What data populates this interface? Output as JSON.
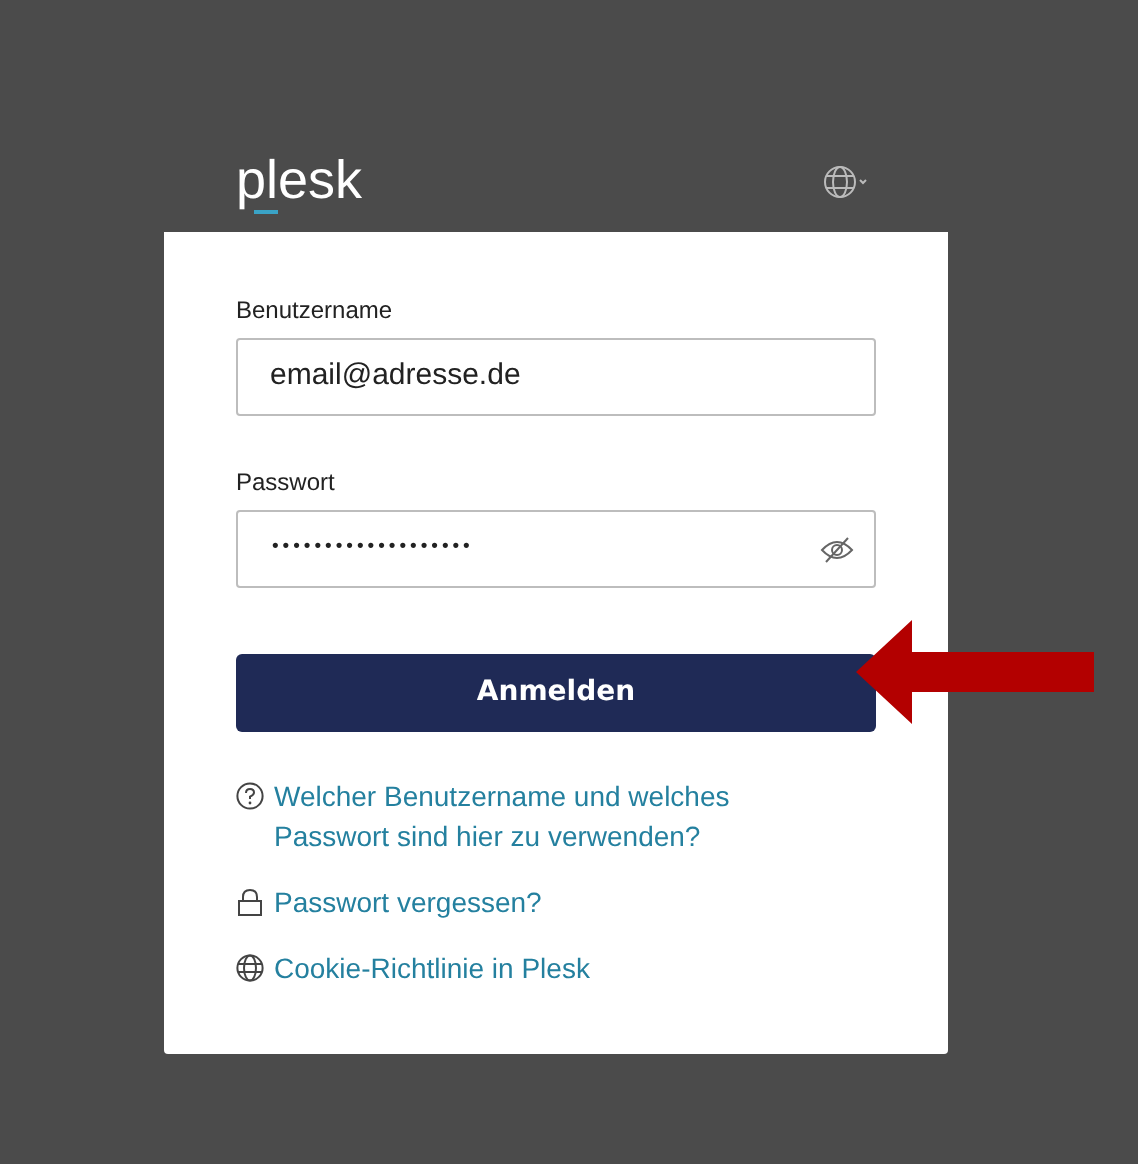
{
  "logo": "plesk",
  "fields": [
    {
      "label": "Benutzername",
      "value": "email@adresse.de",
      "kind": "text"
    },
    {
      "label": "Passwort",
      "value": "•••••••••••••••••••",
      "kind": "password"
    }
  ],
  "login_button": "Anmelden",
  "links": [
    {
      "text": "Welcher Benutzername und welches Passwort sind hier zu verwenden?",
      "kind": "help"
    },
    {
      "text": "Passwort vergessen?",
      "kind": "lock"
    },
    {
      "text": "Cookie-Richtlinie in Plesk",
      "kind": "globe"
    }
  ]
}
